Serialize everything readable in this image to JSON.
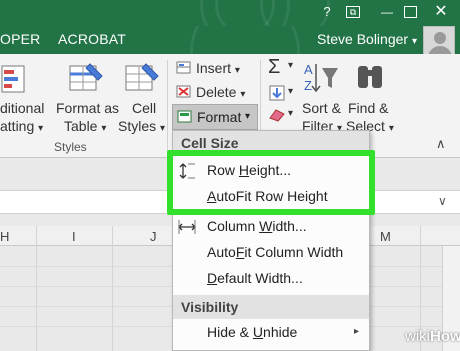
{
  "window": {
    "help": "?",
    "restore": "⧉",
    "minimize": "—"
  },
  "tabs": [
    "OPER",
    "ACROBAT"
  ],
  "user": {
    "name": "Steve Bolinger",
    "caret": "▾"
  },
  "ribbon": {
    "styles": {
      "conditional_line1": "ditional",
      "conditional_line2": "atting",
      "format_table_line1": "Format as",
      "format_table_line2": "Table",
      "cell_styles_line1": "Cell",
      "cell_styles_line2": "Styles",
      "group_label": "Styles"
    },
    "cells": {
      "insert": "Insert",
      "delete": "Delete",
      "format": "Format"
    },
    "editing": {
      "sort_line1": "Sort &",
      "sort_line2": "Filter",
      "find_line1": "Find &",
      "find_line2": "Select"
    },
    "caret": "▾",
    "collapse": "∧"
  },
  "menu": {
    "section_cell_size": "Cell Size",
    "row_height_pre": "Row ",
    "row_height_u": "H",
    "row_height_post": "eight...",
    "autofit_row_u": "A",
    "autofit_row_post": "utoFit Row Height",
    "column_width_pre": "Column ",
    "column_width_u": "W",
    "column_width_post": "idth...",
    "autofit_col_pre": "Auto",
    "autofit_col_u": "F",
    "autofit_col_post": "it Column Width",
    "default_width_u": "D",
    "default_width_post": "efault Width...",
    "section_visibility": "Visibility",
    "hide_unhide_pre": "Hide & ",
    "hide_unhide_u": "U",
    "hide_unhide_post": "nhide",
    "submenu_arrow": "▸"
  },
  "sheet": {
    "columns": [
      "H",
      "I",
      "J",
      "M"
    ]
  },
  "formula_caret": "∨",
  "watermark": {
    "prefix": "wiki",
    "suffix": "How"
  },
  "colors": {
    "excel_green": "#227447",
    "highlight": "#33e02c"
  }
}
